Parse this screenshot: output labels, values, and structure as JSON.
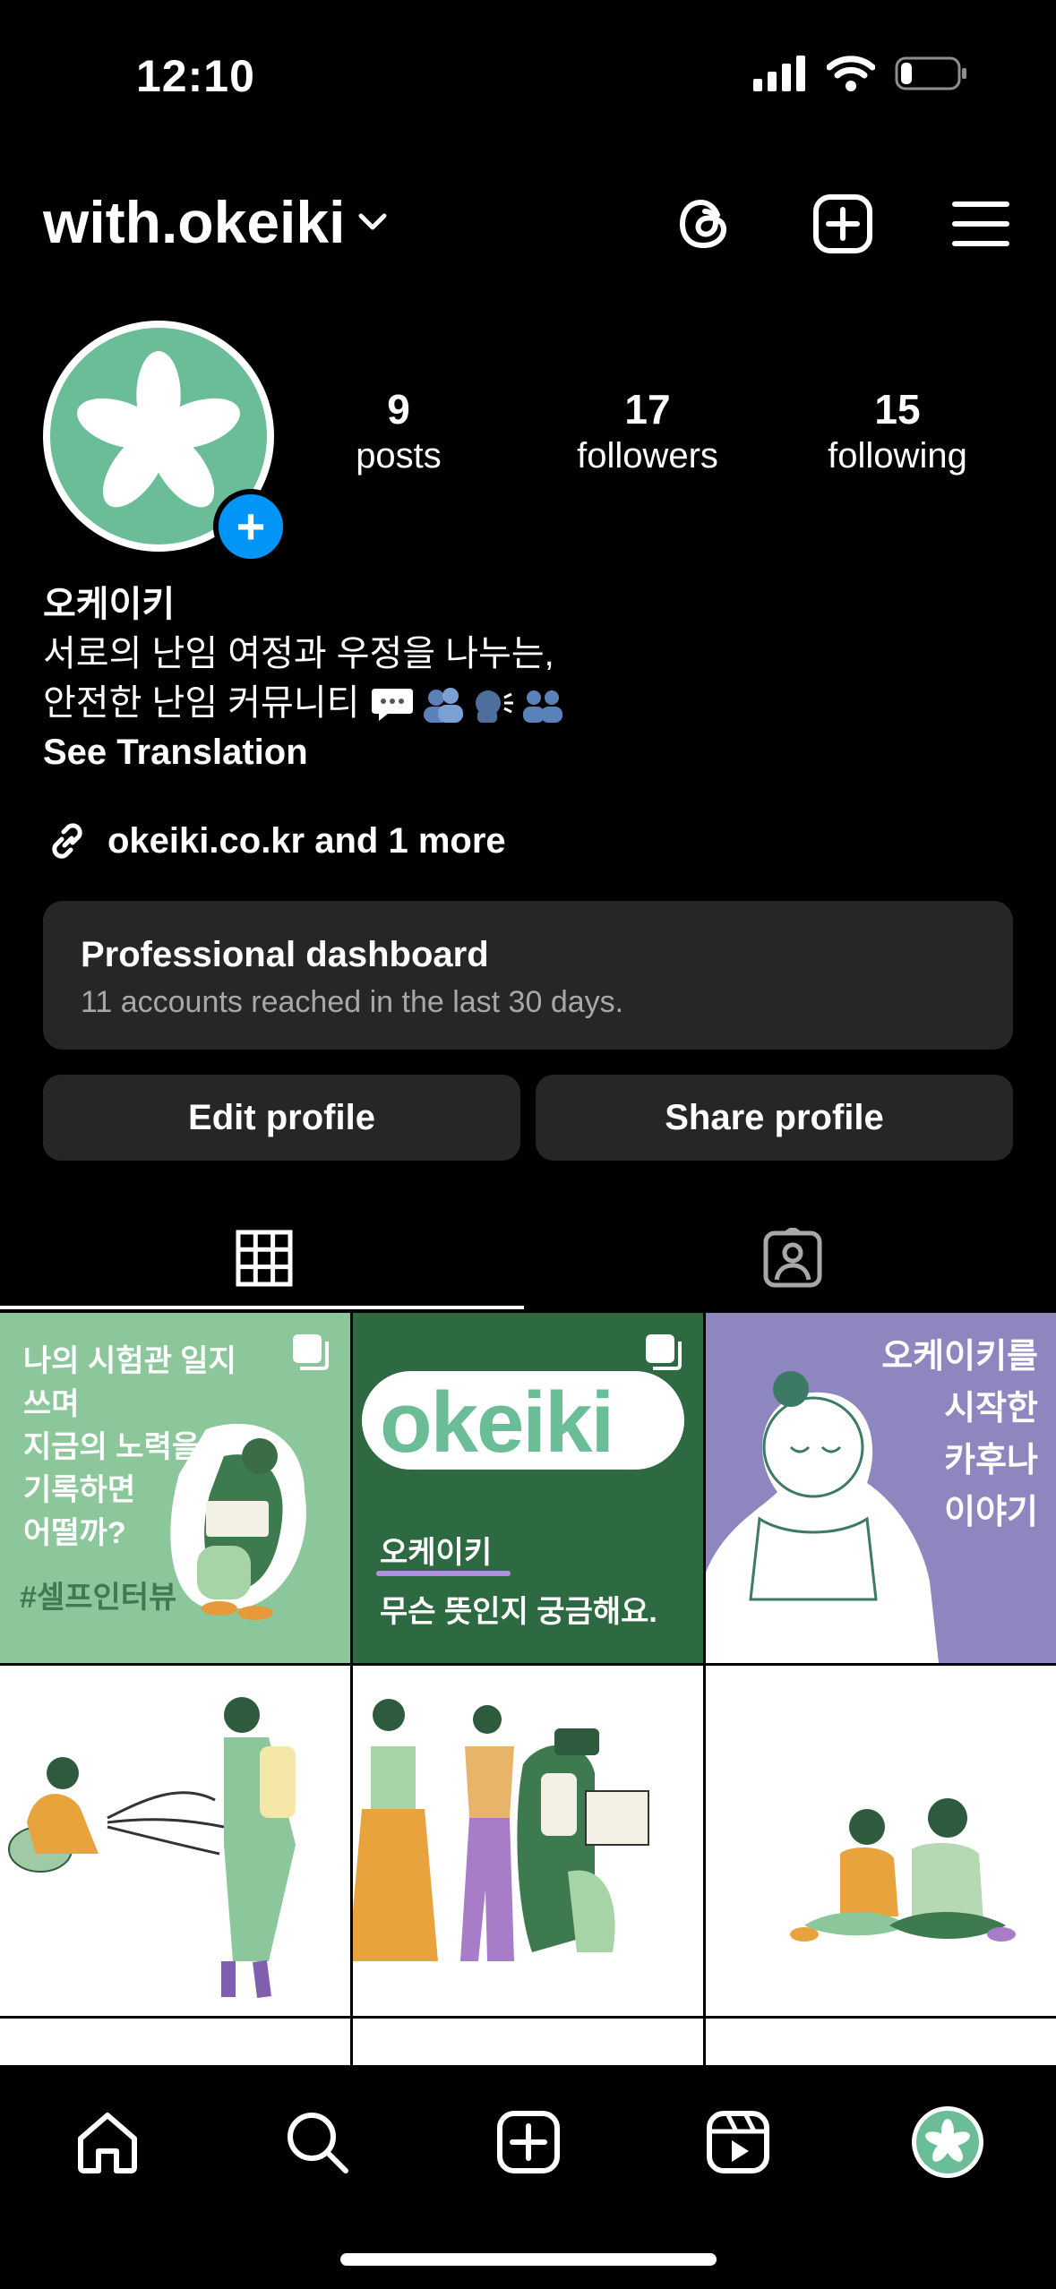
{
  "status_bar": {
    "time": "12:10",
    "battery_level": 0.2
  },
  "header": {
    "username": "with.okeiki"
  },
  "profile": {
    "stats": [
      {
        "value": "9",
        "label": "posts"
      },
      {
        "value": "17",
        "label": "followers"
      },
      {
        "value": "15",
        "label": "following"
      }
    ],
    "add_badge": "+",
    "display_name": "오케이키",
    "bio_line1": "서로의 난임 여정과 우정을 나누는,",
    "bio_line2": "안전한 난임 커뮤니티",
    "see_translation": "See Translation",
    "link_text": "okeiki.co.kr and 1 more"
  },
  "dashboard": {
    "title": "Professional dashboard",
    "subtitle": "11 accounts reached in the last 30 days."
  },
  "buttons": {
    "edit": "Edit profile",
    "share": "Share profile"
  },
  "posts": [
    {
      "lines": [
        "나의 시험관 일지",
        "쓰며",
        "지금의 노력을",
        "기록하면",
        "어떨까?"
      ],
      "tag": "#셀프인터뷰",
      "bg": "#8cc79b"
    },
    {
      "logo": "okeiki",
      "lines": [
        "오케이키",
        "무슨 뜻인지 궁금해요."
      ],
      "bg": "#2e6a41"
    },
    {
      "lines": [
        "오케이키를",
        "시작한",
        "카후나",
        "이야기"
      ],
      "bg": "#8e86bf"
    },
    {
      "bg": "#ffffff"
    },
    {
      "bg": "#ffffff"
    },
    {
      "bg": "#ffffff"
    }
  ],
  "colors": {
    "accent": "#0095f6",
    "brand_green": "#6bbd98",
    "card_bg": "#262626"
  }
}
